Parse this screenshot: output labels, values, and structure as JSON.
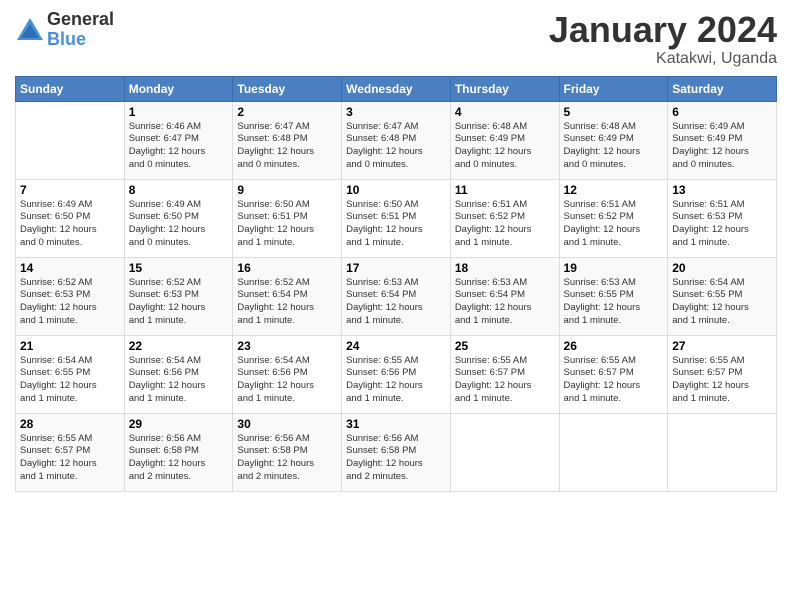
{
  "header": {
    "logo_general": "General",
    "logo_blue": "Blue",
    "month_title": "January 2024",
    "location": "Katakwi, Uganda"
  },
  "days_of_week": [
    "Sunday",
    "Monday",
    "Tuesday",
    "Wednesday",
    "Thursday",
    "Friday",
    "Saturday"
  ],
  "weeks": [
    [
      {
        "day": "",
        "info": ""
      },
      {
        "day": "1",
        "info": "Sunrise: 6:46 AM\nSunset: 6:47 PM\nDaylight: 12 hours\nand 0 minutes."
      },
      {
        "day": "2",
        "info": "Sunrise: 6:47 AM\nSunset: 6:48 PM\nDaylight: 12 hours\nand 0 minutes."
      },
      {
        "day": "3",
        "info": "Sunrise: 6:47 AM\nSunset: 6:48 PM\nDaylight: 12 hours\nand 0 minutes."
      },
      {
        "day": "4",
        "info": "Sunrise: 6:48 AM\nSunset: 6:49 PM\nDaylight: 12 hours\nand 0 minutes."
      },
      {
        "day": "5",
        "info": "Sunrise: 6:48 AM\nSunset: 6:49 PM\nDaylight: 12 hours\nand 0 minutes."
      },
      {
        "day": "6",
        "info": "Sunrise: 6:49 AM\nSunset: 6:49 PM\nDaylight: 12 hours\nand 0 minutes."
      }
    ],
    [
      {
        "day": "7",
        "info": "Sunrise: 6:49 AM\nSunset: 6:50 PM\nDaylight: 12 hours\nand 0 minutes."
      },
      {
        "day": "8",
        "info": "Sunrise: 6:49 AM\nSunset: 6:50 PM\nDaylight: 12 hours\nand 0 minutes."
      },
      {
        "day": "9",
        "info": "Sunrise: 6:50 AM\nSunset: 6:51 PM\nDaylight: 12 hours\nand 1 minute."
      },
      {
        "day": "10",
        "info": "Sunrise: 6:50 AM\nSunset: 6:51 PM\nDaylight: 12 hours\nand 1 minute."
      },
      {
        "day": "11",
        "info": "Sunrise: 6:51 AM\nSunset: 6:52 PM\nDaylight: 12 hours\nand 1 minute."
      },
      {
        "day": "12",
        "info": "Sunrise: 6:51 AM\nSunset: 6:52 PM\nDaylight: 12 hours\nand 1 minute."
      },
      {
        "day": "13",
        "info": "Sunrise: 6:51 AM\nSunset: 6:53 PM\nDaylight: 12 hours\nand 1 minute."
      }
    ],
    [
      {
        "day": "14",
        "info": "Sunrise: 6:52 AM\nSunset: 6:53 PM\nDaylight: 12 hours\nand 1 minute."
      },
      {
        "day": "15",
        "info": "Sunrise: 6:52 AM\nSunset: 6:53 PM\nDaylight: 12 hours\nand 1 minute."
      },
      {
        "day": "16",
        "info": "Sunrise: 6:52 AM\nSunset: 6:54 PM\nDaylight: 12 hours\nand 1 minute."
      },
      {
        "day": "17",
        "info": "Sunrise: 6:53 AM\nSunset: 6:54 PM\nDaylight: 12 hours\nand 1 minute."
      },
      {
        "day": "18",
        "info": "Sunrise: 6:53 AM\nSunset: 6:54 PM\nDaylight: 12 hours\nand 1 minute."
      },
      {
        "day": "19",
        "info": "Sunrise: 6:53 AM\nSunset: 6:55 PM\nDaylight: 12 hours\nand 1 minute."
      },
      {
        "day": "20",
        "info": "Sunrise: 6:54 AM\nSunset: 6:55 PM\nDaylight: 12 hours\nand 1 minute."
      }
    ],
    [
      {
        "day": "21",
        "info": "Sunrise: 6:54 AM\nSunset: 6:55 PM\nDaylight: 12 hours\nand 1 minute."
      },
      {
        "day": "22",
        "info": "Sunrise: 6:54 AM\nSunset: 6:56 PM\nDaylight: 12 hours\nand 1 minute."
      },
      {
        "day": "23",
        "info": "Sunrise: 6:54 AM\nSunset: 6:56 PM\nDaylight: 12 hours\nand 1 minute."
      },
      {
        "day": "24",
        "info": "Sunrise: 6:55 AM\nSunset: 6:56 PM\nDaylight: 12 hours\nand 1 minute."
      },
      {
        "day": "25",
        "info": "Sunrise: 6:55 AM\nSunset: 6:57 PM\nDaylight: 12 hours\nand 1 minute."
      },
      {
        "day": "26",
        "info": "Sunrise: 6:55 AM\nSunset: 6:57 PM\nDaylight: 12 hours\nand 1 minute."
      },
      {
        "day": "27",
        "info": "Sunrise: 6:55 AM\nSunset: 6:57 PM\nDaylight: 12 hours\nand 1 minute."
      }
    ],
    [
      {
        "day": "28",
        "info": "Sunrise: 6:55 AM\nSunset: 6:57 PM\nDaylight: 12 hours\nand 1 minute."
      },
      {
        "day": "29",
        "info": "Sunrise: 6:56 AM\nSunset: 6:58 PM\nDaylight: 12 hours\nand 2 minutes."
      },
      {
        "day": "30",
        "info": "Sunrise: 6:56 AM\nSunset: 6:58 PM\nDaylight: 12 hours\nand 2 minutes."
      },
      {
        "day": "31",
        "info": "Sunrise: 6:56 AM\nSunset: 6:58 PM\nDaylight: 12 hours\nand 2 minutes."
      },
      {
        "day": "",
        "info": ""
      },
      {
        "day": "",
        "info": ""
      },
      {
        "day": "",
        "info": ""
      }
    ]
  ]
}
